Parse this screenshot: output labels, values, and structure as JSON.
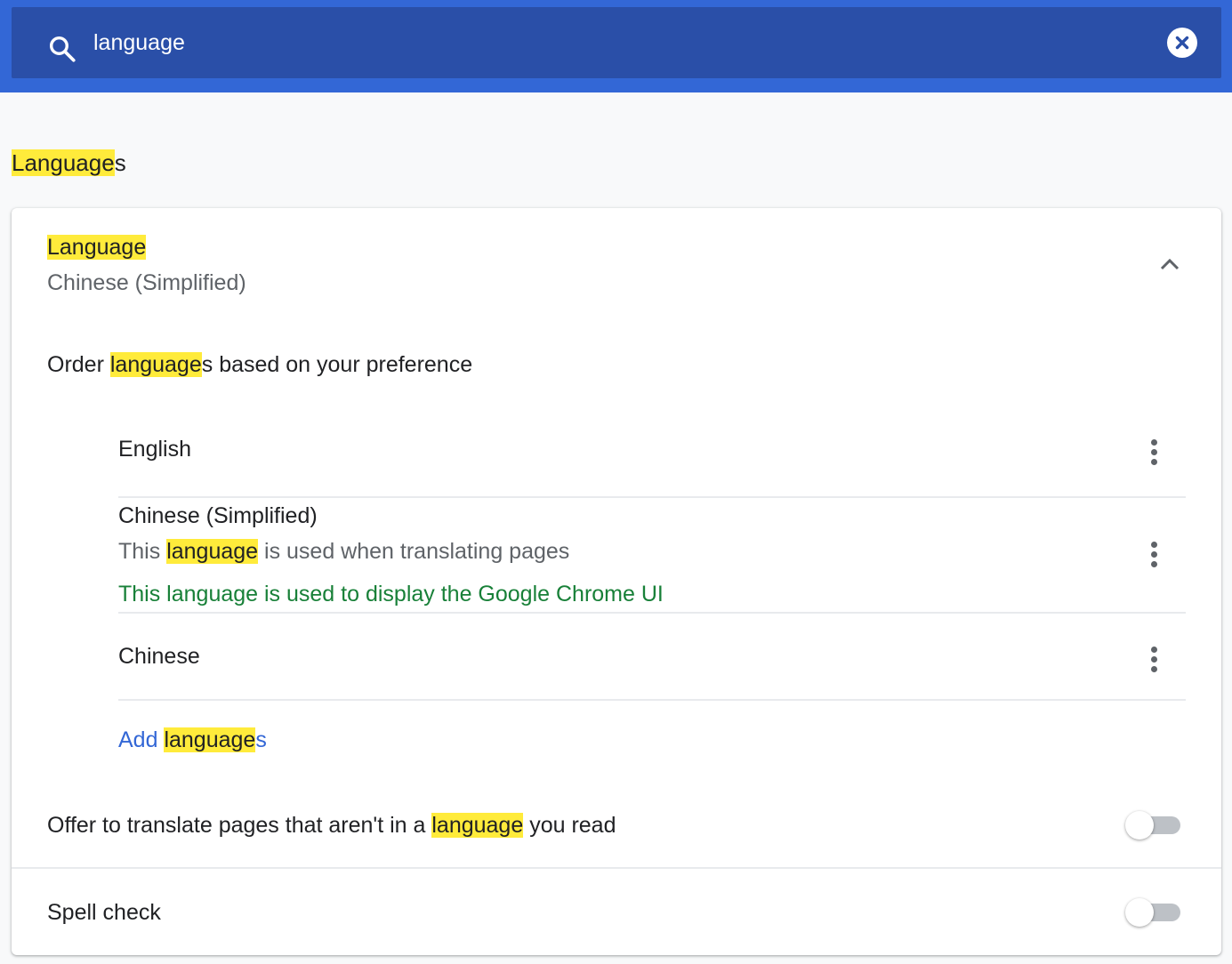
{
  "search": {
    "query": "language",
    "highlight_term": "language"
  },
  "section": {
    "title_highlight": "Language",
    "title_rest": "s"
  },
  "language_dropdown": {
    "label": "Language",
    "value": "Chinese (Simplified)",
    "expanded": true
  },
  "order": {
    "prefix": "Order ",
    "highlight": "language",
    "rest": "s based on your preference"
  },
  "languages": [
    {
      "name": "English"
    },
    {
      "name": "Chinese (Simplified)",
      "translate_note_prefix": "This ",
      "translate_note_highlight": "language",
      "translate_note_rest": " is used when translating pages",
      "ui_note": "This language is used to display the Google Chrome UI"
    },
    {
      "name": "Chinese"
    }
  ],
  "add_languages": {
    "prefix": "Add ",
    "highlight": "language",
    "rest": "s"
  },
  "offer_translate": {
    "prefix": "Offer to translate pages that aren't in a ",
    "highlight": "language",
    "rest": " you read",
    "enabled": false
  },
  "spell_check": {
    "label": "Spell check",
    "enabled": false
  },
  "colors": {
    "header": "#3367d6",
    "search_box": "#2a4fa8",
    "highlight": "#ffeb3b",
    "link": "#3367d6",
    "ui_note": "#188038"
  }
}
